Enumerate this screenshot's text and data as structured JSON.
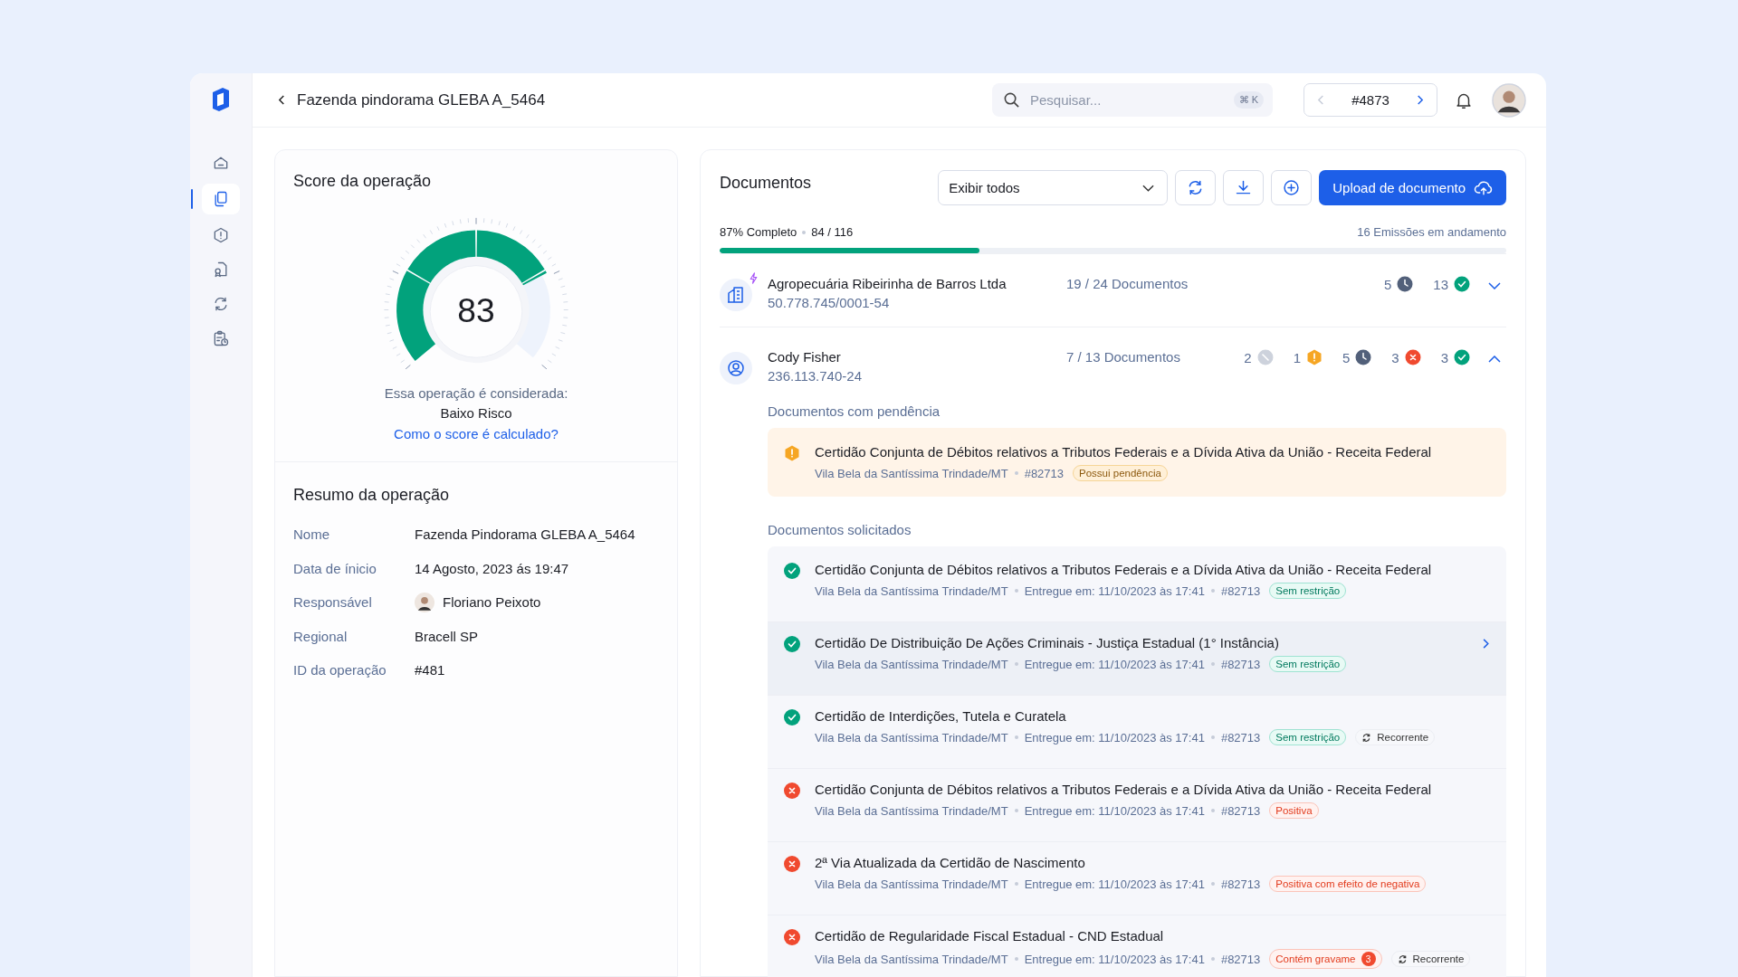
{
  "sidebar": {
    "items": [
      {
        "selected": false
      },
      {
        "selected": true
      },
      {
        "selected": false
      },
      {
        "selected": false
      },
      {
        "selected": false
      },
      {
        "selected": false
      }
    ]
  },
  "topbar": {
    "title": "Fazenda pindorama GLEBA A_5464",
    "search": {
      "placeholder": "Pesquisar...",
      "shortcut": "⌘ K"
    },
    "record": {
      "label": "#4873",
      "prev_disabled": true,
      "next_disabled": false
    }
  },
  "score": {
    "title": "Score da operação",
    "value": "83",
    "caption": "Essa operação é considerada:",
    "rating": "Baixo Risco",
    "link": "Como o score é calculado?"
  },
  "summary": {
    "title": "Resumo da operação",
    "rows": [
      {
        "label": "Nome",
        "value": "Fazenda Pindorama GLEBA A_5464",
        "kind": "text"
      },
      {
        "label": "Data de ínicio",
        "value": "14 Agosto, 2023 ás 19:47",
        "kind": "text"
      },
      {
        "label": "Responsável",
        "value": "Floriano Peixoto",
        "kind": "person"
      },
      {
        "label": "Regional",
        "value": "Bracell SP",
        "kind": "text"
      },
      {
        "label": "ID da operação",
        "value": "#481",
        "kind": "text"
      }
    ]
  },
  "documents": {
    "title": "Documentos",
    "filter": "Exibir todos",
    "upload": "Upload de documento",
    "progress": {
      "completed": "87% Completo",
      "count": "84 / 116",
      "level": 0.33,
      "in_progress": "16 Emissões em andamento"
    },
    "groups": [
      {
        "kind": "company",
        "flagged": true,
        "name": "Agropecuária Ribeirinha de Barros Ltda",
        "doc_id": "50.778.745/0001-54",
        "documents": "19 / 24 Documentos",
        "expanded": false,
        "counts": [
          {
            "kind": "pending",
            "value": "5"
          },
          {
            "kind": "ok",
            "value": "13"
          }
        ]
      },
      {
        "kind": "person",
        "flagged": false,
        "name": "Cody Fisher",
        "doc_id": "236.113.740-24",
        "documents": "7 / 13 Documentos",
        "expanded": true,
        "counts": [
          {
            "kind": "na",
            "value": "2"
          },
          {
            "kind": "warning",
            "value": "1"
          },
          {
            "kind": "pending",
            "value": "5"
          },
          {
            "kind": "error",
            "value": "3"
          },
          {
            "kind": "ok",
            "value": "3"
          }
        ],
        "pending_title": "Documentos com pendência",
        "pending": [
          {
            "kind": "warning",
            "title": "Certidão Conjunta de Débitos relativos a Tributos Federais e a Dívida Ativa da União - Receita Federal",
            "place": "Vila Bela da Santíssima Trindade/MT",
            "ref": "#82713",
            "tags": [
              {
                "kind": "warning",
                "label": "Possui pendência"
              }
            ]
          }
        ],
        "requested_title": "Documentos solicitados",
        "requested": [
          {
            "kind": "ok",
            "selected": false,
            "title": "Certidão Conjunta de Débitos relativos a Tributos Federais e a Dívida Ativa da União - Receita Federal",
            "place": "Vila Bela da Santíssima Trindade/MT",
            "delivered": "Entregue em: 11/10/2023 às 17:41",
            "ref": "#82713",
            "tags": [
              {
                "kind": "success",
                "label": "Sem restrição"
              }
            ]
          },
          {
            "kind": "ok",
            "selected": true,
            "title": "Certidão De Distribuição De Ações Criminais - Justiça Estadual (1° Instância)",
            "place": "Vila Bela da Santíssima Trindade/MT",
            "delivered": "Entregue em: 11/10/2023 às 17:41",
            "ref": "#82713",
            "tags": [
              {
                "kind": "success",
                "label": "Sem restrição"
              }
            ]
          },
          {
            "kind": "ok",
            "selected": false,
            "title": "Certidão de Interdições, Tutela e Curatela",
            "place": "Vila Bela da Santíssima Trindade/MT",
            "delivered": "Entregue em: 11/10/2023 às 17:41",
            "ref": "#82713",
            "tags": [
              {
                "kind": "success",
                "label": "Sem restrição"
              },
              {
                "kind": "recurring",
                "label": "Recorrente"
              }
            ]
          },
          {
            "kind": "error",
            "selected": false,
            "title": "Certidão Conjunta de Débitos relativos a Tributos Federais e a Dívida Ativa da União - Receita Federal",
            "place": "Vila Bela da Santíssima Trindade/MT",
            "delivered": "Entregue em: 11/10/2023 às 17:41",
            "ref": "#82713",
            "tags": [
              {
                "kind": "danger",
                "label": "Positiva"
              }
            ]
          },
          {
            "kind": "error",
            "selected": false,
            "title": "2ª Via Atualizada da Certidão de Nascimento",
            "place": "Vila Bela da Santíssima Trindade/MT",
            "delivered": "Entregue em: 11/10/2023 às 17:41",
            "ref": "#82713",
            "tags": [
              {
                "kind": "danger",
                "label": "Positiva com efeito de negativa"
              }
            ]
          },
          {
            "kind": "error",
            "selected": false,
            "title": "Certidão de Regularidade Fiscal Estadual - CND Estadual",
            "place": "Vila Bela da Santíssima Trindade/MT",
            "delivered": "Entregue em: 11/10/2023 às 17:41",
            "ref": "#82713",
            "tags": [
              {
                "kind": "danger",
                "label": "Contém gravame",
                "count": "3"
              },
              {
                "kind": "recurring",
                "label": "Recorrente"
              }
            ]
          }
        ]
      }
    ]
  }
}
